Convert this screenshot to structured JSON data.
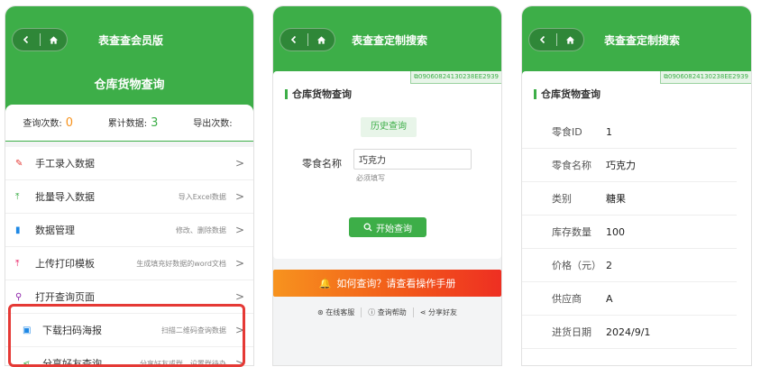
{
  "colors": {
    "brand_green": "#3dae48",
    "accent_orange": "#f7931e",
    "accent_red": "#ee2f22",
    "highlight_box": "#e53935"
  },
  "panel1": {
    "title": "表查查会员版",
    "subtitle": "仓库货物查询",
    "counts": [
      {
        "label": "查询次数:",
        "value": "0",
        "color": "#f7931e"
      },
      {
        "label": "累计数据:",
        "value": "3",
        "color": "#3dae48"
      },
      {
        "label": "导出次数:",
        "value": "",
        "color": "#333333"
      }
    ],
    "menu": [
      {
        "icon": "pencil-icon",
        "label": "手工录入数据",
        "desc": ""
      },
      {
        "icon": "upload-icon",
        "label": "批量导入数据",
        "desc": "导入Excel数据"
      },
      {
        "icon": "bar-chart-icon",
        "label": "数据管理",
        "desc": "修改、删除数据"
      },
      {
        "icon": "upload-icon",
        "label": "上传打印模板",
        "desc": "生成填充好数据的word文档"
      },
      {
        "icon": "search-icon",
        "label": "打开查询页面",
        "desc": ""
      },
      {
        "icon": "image-icon",
        "label": "下载扫码海报",
        "desc": "扫描二维码查询数据"
      },
      {
        "icon": "share-icon",
        "label": "分享好友查询",
        "desc": "分享好友或群、设置群待办"
      }
    ]
  },
  "panel2": {
    "title": "表查查定制搜索",
    "code": "09060824130238EE2939",
    "section_title": "仓库货物查询",
    "history_button": "历史查询",
    "field_label": "零食名称",
    "field_value": "巧克力",
    "field_hint": "必须填写",
    "search_button": "开始查询",
    "banner_text": "如何查询？请查看操作手册",
    "footer": [
      {
        "icon": "headset-icon",
        "label": "在线客服"
      },
      {
        "icon": "help-icon",
        "label": "查询帮助"
      },
      {
        "icon": "share-icon",
        "label": "分享好友"
      }
    ]
  },
  "panel3": {
    "title": "表查查定制搜索",
    "code": "09060824130238EE2939",
    "section_title": "仓库货物查询",
    "rows": [
      {
        "key": "零食ID",
        "value": "1"
      },
      {
        "key": "零食名称",
        "value": "巧克力"
      },
      {
        "key": "类别",
        "value": "糖果"
      },
      {
        "key": "库存数量",
        "value": "100"
      },
      {
        "key": "价格（元）",
        "value": "2"
      },
      {
        "key": "供应商",
        "value": "A"
      },
      {
        "key": "进货日期",
        "value": "2024/9/1"
      }
    ]
  }
}
